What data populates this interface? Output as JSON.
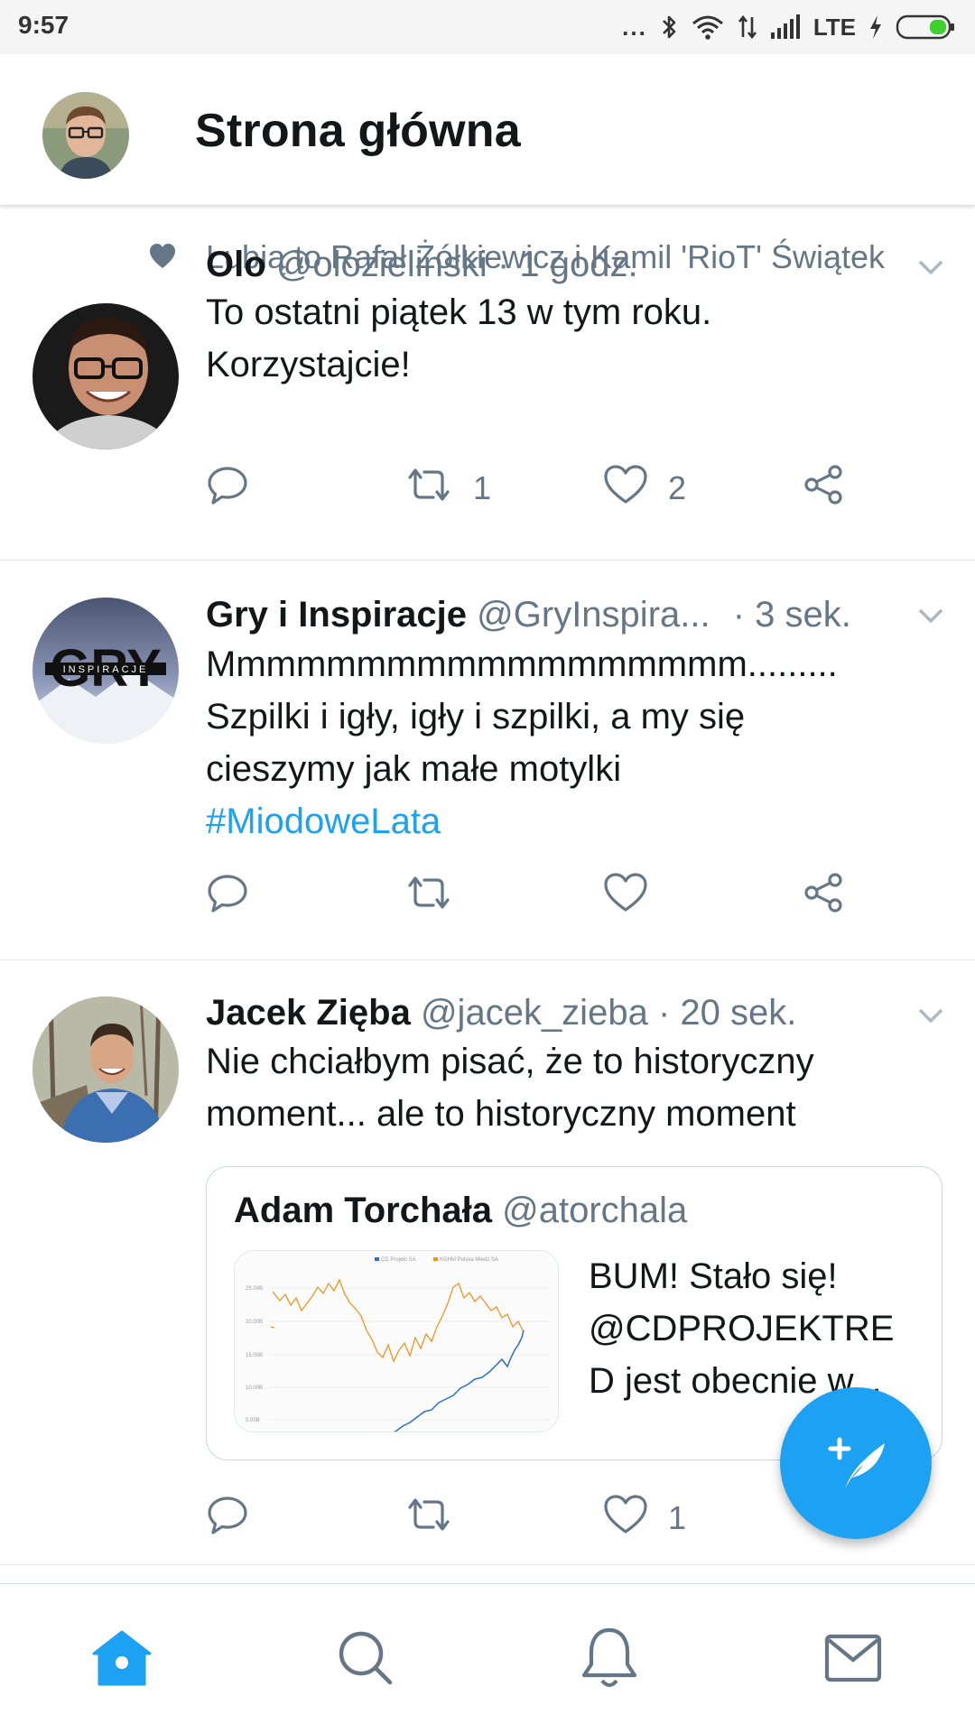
{
  "status_bar": {
    "time": "9:57",
    "dots": "...",
    "network": "LTE",
    "icons": [
      "bluetooth-icon",
      "wifi-icon",
      "data-arrows-icon",
      "signal-icon",
      "charging-icon",
      "battery-icon"
    ]
  },
  "header": {
    "title": "Strona główna",
    "avatar_icon": "profile-avatar"
  },
  "colors": {
    "accent": "#1da1f2",
    "secondary_text": "#657786",
    "primary_text": "#14171a",
    "divider": "#e1e8ed"
  },
  "tweets": [
    {
      "social_context": "Lubią to Rafał Żółkiewicz i Kamil 'RioT' Świątek",
      "name": "Olo",
      "handle": "@olozielinski",
      "time": "· 1 godz.",
      "lines": [
        "To ostatni piątek 13 w tym roku.",
        "Korzystajcie!"
      ],
      "retweets": "1",
      "likes": "2"
    },
    {
      "name": "Gry i Inspiracje",
      "handle": "@GryInspira...",
      "time": "· 3 sek.",
      "lines": [
        "Mmmmmmmmmmmmmmmmmm.........",
        "Szpilki i igły, igły i szpilki, a my się",
        "cieszymy jak małe motylki"
      ],
      "hashtag": "#MiodoweLata",
      "avatar_text": "GRY",
      "avatar_subtext": "INSPIRACJE"
    },
    {
      "name": "Jacek Zięba",
      "handle": "@jacek_zieba",
      "time": "· 20 sek.",
      "lines": [
        "Nie chciałbym pisać, że to historyczny",
        "moment... ale to historyczny moment"
      ],
      "likes": "1",
      "quote": {
        "name": "Adam Torchała",
        "handle": "@atorchala",
        "lines": [
          "BUM! Stało się!",
          "@CDPROJEKTRE",
          "D jest obecnie w..."
        ],
        "chart_legend": [
          "CD Projekt SA",
          "KGHM Polska Miedz SA"
        ],
        "chart_ticks": [
          "25.00B",
          "20.00B",
          "15.00B",
          "10.00B",
          "5.00B"
        ]
      }
    }
  ],
  "bottom_nav": [
    "home-icon",
    "search-icon",
    "notifications-icon",
    "messages-icon"
  ],
  "fab": "compose-tweet-icon"
}
